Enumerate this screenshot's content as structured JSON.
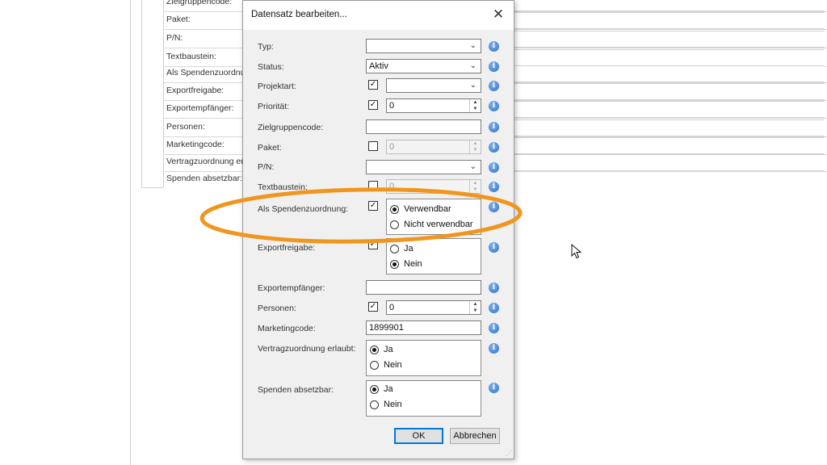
{
  "background": {
    "rows": [
      "Zielgruppencode:",
      "Paket:",
      "P/N:",
      "Textbaustein:",
      "Als Spendenzuordnung:",
      "Exportfreigabe:",
      "Exportempfänger:",
      "Personen:",
      "Marketingcode:",
      "Vertragzuordnung erlaubt:",
      "Spenden absetzbar:"
    ]
  },
  "dialog": {
    "title": "Datensatz bearbeiten...",
    "close": "✕",
    "info_icon": "i",
    "fields": {
      "typ": {
        "label": "Typ:",
        "value": ""
      },
      "status": {
        "label": "Status:",
        "value": "Aktiv"
      },
      "projektart": {
        "label": "Projektart:",
        "value": ""
      },
      "prioritaet": {
        "label": "Priorität:",
        "value": "0"
      },
      "zielgruppencode": {
        "label": "Zielgruppencode:",
        "value": ""
      },
      "paket": {
        "label": "Paket:",
        "value": "0"
      },
      "pn": {
        "label": "P/N:",
        "value": ""
      },
      "textbaustein": {
        "label": "Textbaustein:",
        "value": "0"
      },
      "spendenzuordnung": {
        "label": "Als Spendenzuordnung:",
        "options": [
          "Verwendbar",
          "Nicht verwendbar"
        ],
        "selected": "Verwendbar"
      },
      "exportfreigabe": {
        "label": "Exportfreigabe:",
        "options": [
          "Ja",
          "Nein"
        ],
        "selected": "Nein"
      },
      "exportempfaenger": {
        "label": "Exportempfänger:",
        "value": ""
      },
      "personen": {
        "label": "Personen:",
        "value": "0"
      },
      "marketingcode": {
        "label": "Marketingcode:",
        "value": "1899901"
      },
      "vertragzuordnung": {
        "label": "Vertragzuordnung erlaubt:",
        "options": [
          "Ja",
          "Nein"
        ],
        "selected": "Ja"
      },
      "spenden_absetzbar": {
        "label": "Spenden absetzbar:",
        "options": [
          "Ja",
          "Nein"
        ],
        "selected": "Ja"
      }
    },
    "buttons": {
      "ok": "OK",
      "cancel": "Abbrechen"
    }
  },
  "annotation": {
    "color": "#f0961e"
  },
  "colors": {
    "accent": "#0078d7",
    "info": "#2f6fc6"
  }
}
